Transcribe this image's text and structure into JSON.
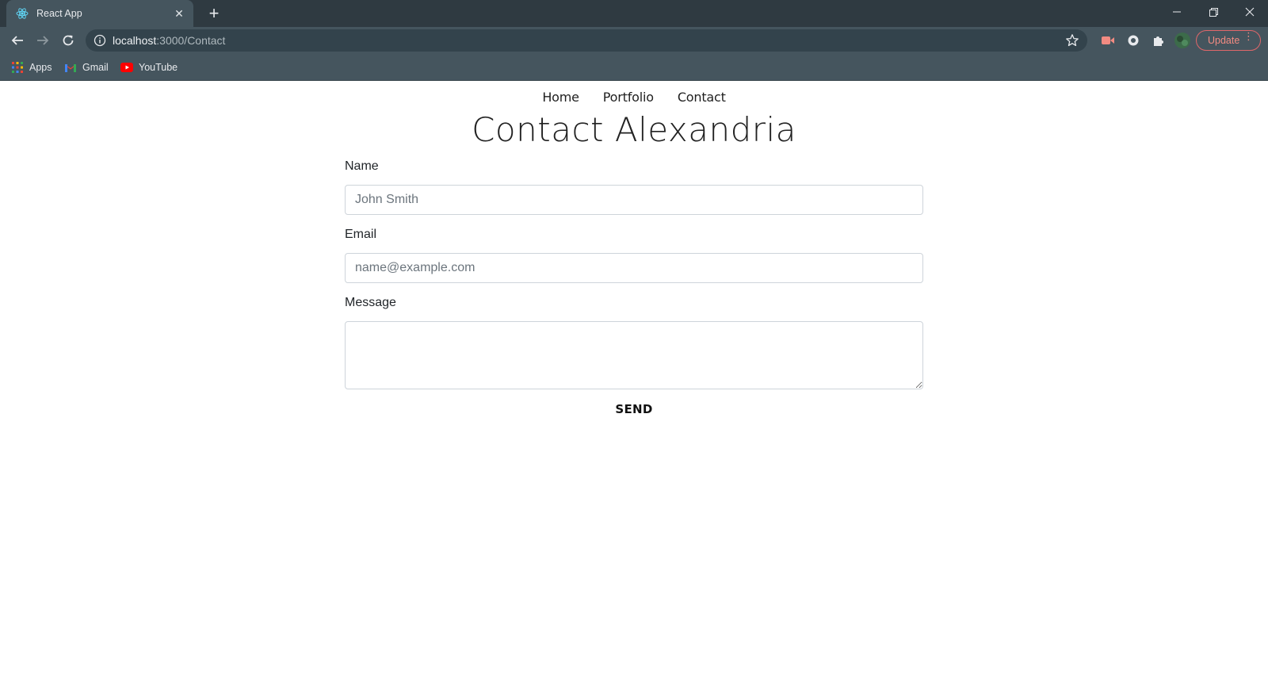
{
  "browser": {
    "tab_title": "React App",
    "url_host": "localhost",
    "url_path": ":3000/Contact",
    "update_label": "Update",
    "bookmarks": [
      {
        "label": "Apps",
        "icon": "apps-grid-icon"
      },
      {
        "label": "Gmail",
        "icon": "gmail-icon"
      },
      {
        "label": "YouTube",
        "icon": "youtube-icon"
      }
    ],
    "colors": {
      "chrome_dark": "#2f3a41",
      "chrome": "#45555e",
      "update_accent": "#f28b82"
    }
  },
  "page": {
    "nav": [
      {
        "label": "Home"
      },
      {
        "label": "Portfolio"
      },
      {
        "label": "Contact"
      }
    ],
    "title": "Contact Alexandria",
    "form": {
      "name": {
        "label": "Name",
        "placeholder": "John Smith",
        "value": ""
      },
      "email": {
        "label": "Email",
        "placeholder": "name@example.com",
        "value": ""
      },
      "message": {
        "label": "Message",
        "value": ""
      },
      "submit_label": "SEND"
    }
  }
}
